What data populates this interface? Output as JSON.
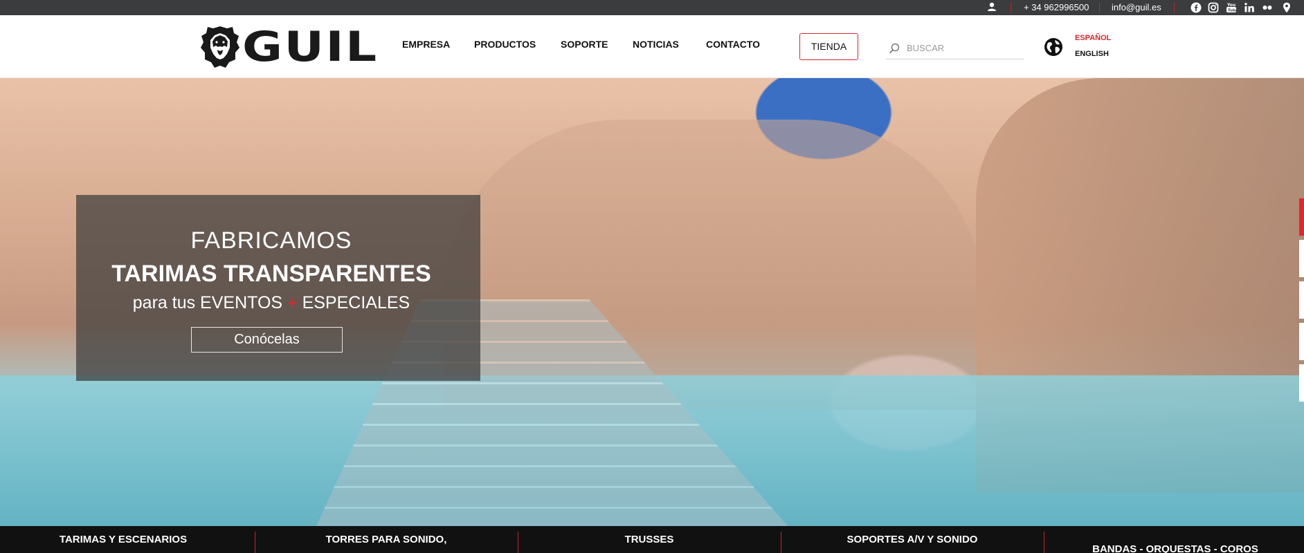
{
  "topbar": {
    "phone": "+ 34 962996500",
    "email": "info@guil.es",
    "icons": [
      "user-icon",
      "facebook-icon",
      "instagram-icon",
      "youtube-icon",
      "linkedin-icon",
      "flickr-icon",
      "location-pin-icon"
    ]
  },
  "header": {
    "logo_text": "GUIL",
    "logo_mark": "®",
    "nav": [
      "EMPRESA",
      "PRODUCTOS",
      "SOPORTE",
      "NOTICIAS",
      "CONTACTO"
    ],
    "store_button": "TIENDA",
    "search_placeholder": "BUSCAR",
    "languages": [
      "ESPAÑOL",
      "ENGLISH"
    ],
    "active_language": "ESPAÑOL"
  },
  "hero": {
    "line1": "FABRICAMOS",
    "line2": "TARIMAS TRANSPARENTES",
    "line3_a": "para tus EVENTOS",
    "line3_plus": "+",
    "line3_b": "ESPECIALES",
    "cta": "Conócelas",
    "slides_count": 5,
    "active_slide": 1
  },
  "categories": [
    "TARIMAS Y ESCENARIOS",
    "TORRES PARA SONIDO,",
    "TRUSSES",
    "SOPORTES A/V Y SONIDO",
    "BANDAS - ORQUESTAS - COROS"
  ],
  "colors": {
    "accent": "#d9262c",
    "topbar_bg": "#3b3c3e",
    "category_bg": "#111111"
  }
}
